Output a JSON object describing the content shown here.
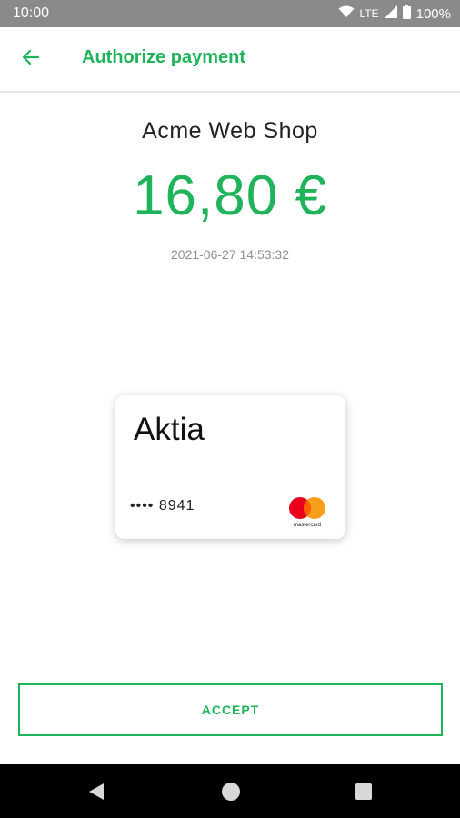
{
  "status_bar": {
    "time": "10:00",
    "network": "LTE",
    "battery": "100%",
    "icons": [
      "wifi-icon",
      "signal-icon",
      "battery-icon"
    ]
  },
  "app_bar": {
    "title": "Authorize payment",
    "back_icon": "arrow-left-icon"
  },
  "payment": {
    "merchant": "Acme Web Shop",
    "amount": "16,80 €",
    "timestamp": "2021-06-27 14:53:32"
  },
  "card": {
    "bank": "Aktia",
    "number_masked": "•••• 8941",
    "network_icon": "mastercard-logo",
    "network_text": "mastercard"
  },
  "actions": {
    "accept_label": "ACCEPT"
  },
  "nav_bar": {
    "icons": [
      "back-triangle-icon",
      "home-circle-icon",
      "recents-square-icon"
    ]
  },
  "colors": {
    "accent": "#1fb35a",
    "status_bar": "#8a8a8a",
    "nav_bar": "#000000",
    "timestamp": "#8f8f8f",
    "mastercard_red": "#eb001b",
    "mastercard_orange": "#f79e1b"
  }
}
